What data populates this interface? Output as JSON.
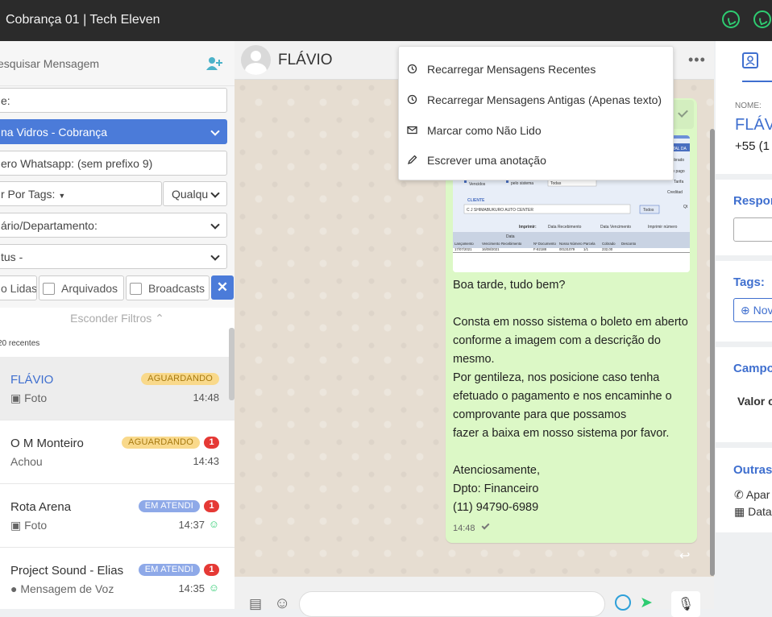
{
  "topbar": {
    "title": "Cobrança 01 | Tech Eleven"
  },
  "left": {
    "search_placeholder": "esquisar Mensagem",
    "filters": {
      "name": "e:",
      "queue": "na Vidros - Cobrança",
      "whatsapp": "ero Whatsapp: (sem prefixo 9)",
      "tags": "r Por Tags:",
      "tags_mode": "Qualqu",
      "user": "ário/Departamento:",
      "status": "tus -",
      "unread": "o Lidas",
      "archived": "Arquivados",
      "broadcasts": "Broadcasts"
    },
    "hide_filters": "Esconder Filtros",
    "recent": "20 recentes",
    "conversations": [
      {
        "name": "FLÁVIO",
        "badge": "AGUARDANDO",
        "sub": "Foto",
        "time": "14:48"
      },
      {
        "name": "O M Monteiro",
        "badge": "AGUARDANDO",
        "count": "1",
        "sub": "Achou",
        "time": "14:43"
      },
      {
        "name": "Rota Arena",
        "badge": "EM ATENDI",
        "count": "1",
        "sub": "Foto",
        "time": "14:37"
      },
      {
        "name": "Project Sound - Elias",
        "badge": "EM ATENDI",
        "count": "1",
        "sub": "Mensagem de Voz",
        "time": "14:35"
      }
    ]
  },
  "chat": {
    "name": "FLÁVIO",
    "message": "Boa tarde, tudo bem?\n\nConsta em nosso sistema o boleto em aberto conforme a imagem com a descrição do mesmo.\nPor gentileza, nos posicione caso tenha efetuado o pagamento e nos encaminhe o comprovante para que possamos\nfazer a baixa em nosso sistema por favor.\n\nAtenciosamente,\nDpto: Financeiro\n(11) 94790-6989",
    "time": "14:48",
    "screenshot": {
      "cols": [
        "Lançamento",
        "Vencimento",
        "Recebimento",
        "Nº Documento",
        "Nosso Número",
        "Parcela",
        "Cobrado",
        "Desconto"
      ],
      "row": [
        "17/07/2021",
        "16/08/2021",
        "",
        "F-82188",
        "00131079",
        "1/1",
        "232,00",
        ""
      ],
      "client": "C J SHIMABUKURO AUTO CENTER",
      "client_label": "CLIENTE",
      "options": [
        "Vencidos",
        "pelo sistema",
        "Todas",
        "Todos"
      ],
      "print": "Imprimir:",
      "radio": [
        "Data Recebimento",
        "Data Vencimento",
        "Imprimir número"
      ],
      "side": [
        "TOTAL DA",
        "Cobrado",
        "Não pago",
        "Tarifa",
        "Creditad",
        "Qt"
      ],
      "date_header": "Data"
    }
  },
  "menu": {
    "items": [
      "Recarregar Mensagens Recentes",
      "Recarregar Mensagens Antigas (Apenas texto)",
      "Marcar como Não Lido",
      "Escrever uma anotação"
    ]
  },
  "right": {
    "name_label": "NOME:",
    "name": "FLÁV",
    "phone": "+55 (1",
    "responsible": "Respon",
    "tags": "Tags:",
    "new_tag": "Nov",
    "fields": "Campo",
    "value": "Valor c",
    "others": "Outras",
    "device": "Apar",
    "date": "Data"
  },
  "colors": {
    "accent": "#4b7bd9",
    "whatsapp": "#2ecc71",
    "bubble": "#dcf8c6"
  }
}
